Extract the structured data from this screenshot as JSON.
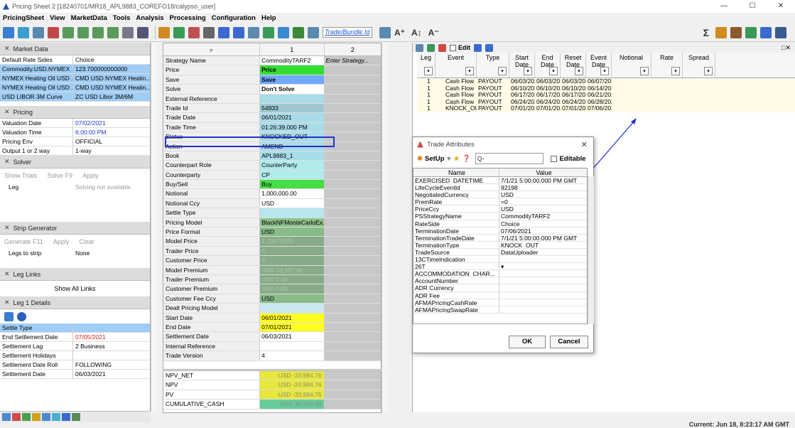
{
  "window": {
    "title": "Pricing Sheet 2 [18240701/MR18_APL9883_COREFO18/calypso_user]",
    "min": "—",
    "max": "☐",
    "close": "✕"
  },
  "menu": [
    "PricingSheet",
    "View",
    "MarketData",
    "Tools",
    "Analysis",
    "Processing",
    "Configuration",
    "Help"
  ],
  "toolbar": {
    "trade_placeholder": "Trade/Bundle Id",
    "font_buttons": [
      "A⁺",
      "A↕",
      "A⁻"
    ]
  },
  "left": {
    "market_data": {
      "title": "Market Data",
      "rows": [
        [
          "Default Rate Sides",
          "Choice"
        ],
        [
          "Commodity.USD.NYMEX ...",
          "123.700000000000"
        ],
        [
          "NYMEX Heating Oil USD ...",
          "CMD USD NYMEX Heatin..."
        ],
        [
          "NYMEX Heating Oil USD ...",
          "CMD USD NYMEX Heatin..."
        ],
        [
          "USD LIBOR 3M Curve",
          "ZC USD Libor 3M/6M"
        ]
      ]
    },
    "pricing": {
      "title": "Pricing",
      "rows": [
        [
          "Valuation Date",
          "07/02/2021"
        ],
        [
          "Valuation Time",
          "6:00:00 PM"
        ],
        [
          "Pricing Env",
          "OFFICIAL"
        ],
        [
          "Output 1 or 2 way",
          "1-way"
        ]
      ]
    },
    "solver": {
      "title": "Solver",
      "buttons": [
        "Show Trials",
        "Solve F9",
        "Apply"
      ],
      "leg_label": "Leg",
      "leg_value": "Solving not available"
    },
    "strip": {
      "title": "Strip Generator",
      "buttons": [
        "Generate F11",
        "Apply",
        "Clear"
      ],
      "legs_label": "Legs to strip",
      "legs_value": "None"
    },
    "leg_links": {
      "title": "Leg Links",
      "button": "Show All Links"
    },
    "leg1": {
      "title": "Leg 1 Details",
      "rows": [
        [
          "Settle Type",
          ""
        ],
        [
          "End Settlement Date",
          "07/05/2021"
        ],
        [
          "Settlement Lag",
          "2 Business"
        ],
        [
          "Settlement Holidays",
          ""
        ],
        [
          "Settlement Date Roll",
          "FOLLOWING"
        ],
        [
          "Settlement Date",
          "06/03/2021"
        ]
      ]
    }
  },
  "grid": {
    "col_headers": [
      "",
      "1",
      "2"
    ],
    "rows": [
      [
        "Strategy Name",
        "CommodityTARF2",
        "Enter Strategy...",
        "#fff"
      ],
      [
        "Price",
        "Price",
        "",
        "#33dd33"
      ],
      [
        "Save",
        "Save",
        "",
        "#6fa8ff"
      ],
      [
        "Solve",
        "Don't Solve",
        "",
        "#fff"
      ],
      [
        "External Reference",
        "",
        "",
        "#a8dce8"
      ],
      [
        "Trade Id",
        "54933",
        "",
        "#9ec8d0"
      ],
      [
        "Trade Date",
        "06/01/2021",
        "",
        "#a8dce8"
      ],
      [
        "Trade Time",
        "01:26:39.000 PM",
        "",
        "#a8dce8"
      ],
      [
        "Status",
        "KNOCKED_OUT",
        "",
        "#a8dce8"
      ],
      [
        "Action",
        "AMEND",
        "",
        "#a8dce8"
      ],
      [
        "Book",
        "APL9883_1",
        "",
        "#a8dce8"
      ],
      [
        "Counterpart Role",
        "CounterParty",
        "",
        "#b0ecec"
      ],
      [
        "Counterparty",
        "CP",
        "",
        "#b0ecec"
      ],
      [
        "Buy/Sell",
        "Buy",
        "",
        "#44dd44"
      ],
      [
        "Notional",
        "1,000,000.00",
        "",
        "#fff"
      ],
      [
        "Notional Ccy",
        "USD",
        "",
        "#fff"
      ],
      [
        "Settle Type",
        "",
        "",
        "#b8e6ee"
      ],
      [
        "Pricing Model",
        "BlackNFMonteCarloEx...",
        "",
        "#8cc08c"
      ],
      [
        "Price Format",
        "USD",
        "",
        "#88bb88"
      ],
      [
        "Model Price",
        "1.73479335",
        "",
        "#88aa88"
      ],
      [
        "Trader Price",
        "0",
        "",
        "#88aa88"
      ],
      [
        "Customer Price",
        "0",
        "",
        "#88aa88"
      ],
      [
        "Model Premium",
        "USD 33,987.96",
        "",
        "#88aa88"
      ],
      [
        "Trader Premium",
        "USD 0.00",
        "",
        "#88aa88"
      ],
      [
        "Customer Premium",
        "USD 0.00",
        "",
        "#88aa88"
      ],
      [
        "Customer Fee Ccy",
        "USD",
        "",
        "#88bb88"
      ],
      [
        "Dealt Pricing Model",
        "",
        "",
        "#cce8ee"
      ],
      [
        "Start Date",
        "06/01/2021",
        "",
        "#ffff22"
      ],
      [
        "End Date",
        "07/01/2021",
        "",
        "#ffff22"
      ],
      [
        "Settlement Date",
        "06/03/2021",
        "",
        "#fff"
      ],
      [
        "Internal Reference",
        "",
        "",
        "#fff"
      ],
      [
        "Trade Version",
        "4",
        "",
        "#fff"
      ]
    ],
    "summary": [
      [
        "NPV_NET",
        "USD  -33,984.76",
        "#e8e83a"
      ],
      [
        "NPV",
        "USD  -33,984.76",
        "#e8e83a"
      ],
      [
        "PV",
        "USD  -33,984.76",
        "#e8e83a"
      ],
      [
        "CUMULATIVE_CASH",
        "USD  30,000.00",
        "#66cc99"
      ]
    ]
  },
  "legs": {
    "edit_label": "Edit",
    "headers": [
      "Leg",
      "Event",
      "Type",
      "Start Date",
      "End Date",
      "Reset Date",
      "Event Date",
      "Notional",
      "Rate",
      "Spread"
    ],
    "rows": [
      [
        "1",
        "Cash Flow",
        "PAYOUT",
        "06/03/2021",
        "06/03/2021",
        "06/03/2021",
        "06/07/2021"
      ],
      [
        "1",
        "Cash Flow",
        "PAYOUT",
        "06/10/2021",
        "06/10/2021",
        "06/10/2021",
        "06/14/2021"
      ],
      [
        "1",
        "Cash Flow",
        "PAYOUT",
        "06/17/2021",
        "06/17/2021",
        "06/17/2021",
        "06/21/2021"
      ],
      [
        "1",
        "Cash Flow",
        "PAYOUT",
        "06/24/2021",
        "06/24/2021",
        "06/24/2021",
        "06/28/2021"
      ],
      [
        "1",
        "KNOCK_OUT",
        "PAYOUT",
        "07/01/2021",
        "07/01/2021",
        "07/01/2021",
        "07/06/2021"
      ]
    ]
  },
  "dialog": {
    "title": "Trade Attributes",
    "setup": "SetUp",
    "search_placeholder": "Q-",
    "editable": "Editable",
    "headers": [
      "Name",
      "Value"
    ],
    "rows": [
      [
        "EXERCISED_DATETIME",
        "7/1/21 5:00:00.000 PM GMT"
      ],
      [
        "LifeCycleEventId",
        "92198"
      ],
      [
        "NegotiatedCurrency",
        "USD"
      ],
      [
        "PremRate",
        "=0"
      ],
      [
        "PriceCcy",
        "USD"
      ],
      [
        "PSStrategyName",
        "CommodityTARF2"
      ],
      [
        "RateSide",
        "Choice"
      ],
      [
        "TerminationDate",
        "07/06/2021"
      ],
      [
        "TerminationTradeDate",
        "7/1/21 5:00:00.000 PM GMT"
      ],
      [
        "TerminationType",
        "KNOCK_OUT"
      ],
      [
        "TradeSource",
        "DataUploader"
      ],
      [
        "13CTimeIndication",
        ""
      ],
      [
        "26T",
        "▾"
      ],
      [
        "ACCOMMODATION_CHAR...",
        ""
      ],
      [
        "AccountNumber",
        ""
      ],
      [
        "ADR Currency",
        ""
      ],
      [
        "ADR Fee",
        ""
      ],
      [
        "AFMAPricingCashRate",
        ""
      ],
      [
        "AFMAPricingSwapRate",
        ""
      ]
    ],
    "ok": "OK",
    "cancel": "Cancel"
  },
  "status": {
    "clock": "Current: Jun 18, 8:23:17 AM GMT"
  }
}
